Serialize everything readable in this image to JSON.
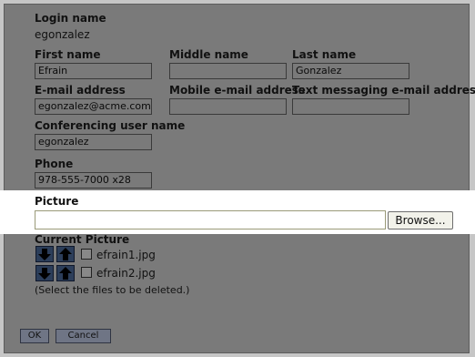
{
  "login": {
    "label": "Login name",
    "value": "egonzalez"
  },
  "first_name": {
    "label": "First name",
    "value": "Efrain"
  },
  "middle_name": {
    "label": "Middle name",
    "value": ""
  },
  "last_name": {
    "label": "Last name",
    "value": "Gonzalez"
  },
  "email": {
    "label": "E-mail address",
    "value": "egonzalez@acme.com"
  },
  "mobile_email": {
    "label": "Mobile e-mail address",
    "value": ""
  },
  "text_email": {
    "label": "Text messaging e-mail address",
    "value": ""
  },
  "conf_user": {
    "label": "Conferencing user name",
    "value": "egonzalez"
  },
  "phone": {
    "label": "Phone",
    "value": "978-555-7000 x28"
  },
  "picture": {
    "label": "Picture",
    "value": "",
    "browse_label": "Browse..."
  },
  "current_picture": {
    "label": "Current Picture",
    "files": [
      {
        "name": "efrain1.jpg",
        "up_icon": "arrow-up-icon",
        "down_icon": "arrow-down-icon"
      },
      {
        "name": "efrain2.jpg",
        "up_icon": "arrow-up-icon",
        "down_icon": "arrow-down-icon"
      }
    ],
    "note": "(Select the files to be deleted.)"
  },
  "buttons": {
    "ok": "OK",
    "cancel": "Cancel"
  },
  "colors": {
    "overlay": "#7a7a7a",
    "highlight": "#ffffff",
    "arrow_button": "#2c3e5a"
  }
}
